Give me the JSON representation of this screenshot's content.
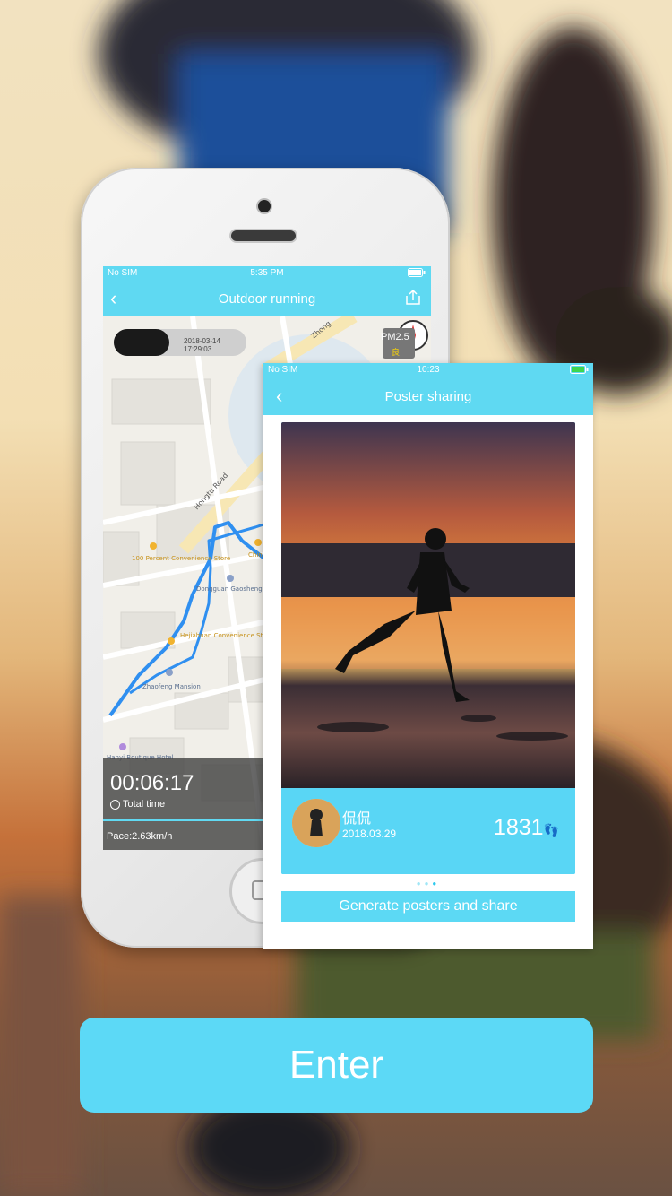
{
  "run_screen": {
    "status": {
      "carrier": "No SIM",
      "time": "5:35 PM"
    },
    "title": "Outdoor running",
    "timestamp": "2018-03-14 17:29:03",
    "pm_label": "PM2.5",
    "pm_quality": "良",
    "map_labels": {
      "road1": "Hongtu Road",
      "road2": "Zhong",
      "store1": "100 Percent Convenience Store",
      "bldg": "Dongguan Gaosheng Science and Technology Park Block A",
      "store2": "Hejiahuan Convenience Store",
      "mansion": "Zhaofeng Mansion",
      "hotel": "Hanyi Boutique Hotel",
      "off": "Chin Off"
    },
    "duration": "00:06:17",
    "duration_label": "Total time",
    "pace": "Pace:2.63km/h"
  },
  "poster_screen": {
    "status": {
      "carrier": "No SIM",
      "time": "10:23"
    },
    "title": "Poster sharing",
    "user_name": "侃侃",
    "date": "2018.03.29",
    "steps": "1831",
    "generate_label": "Generate posters and share"
  },
  "enter_label": "Enter",
  "colors": {
    "accent": "#5cd9f6",
    "route": "#2f8ff0"
  }
}
